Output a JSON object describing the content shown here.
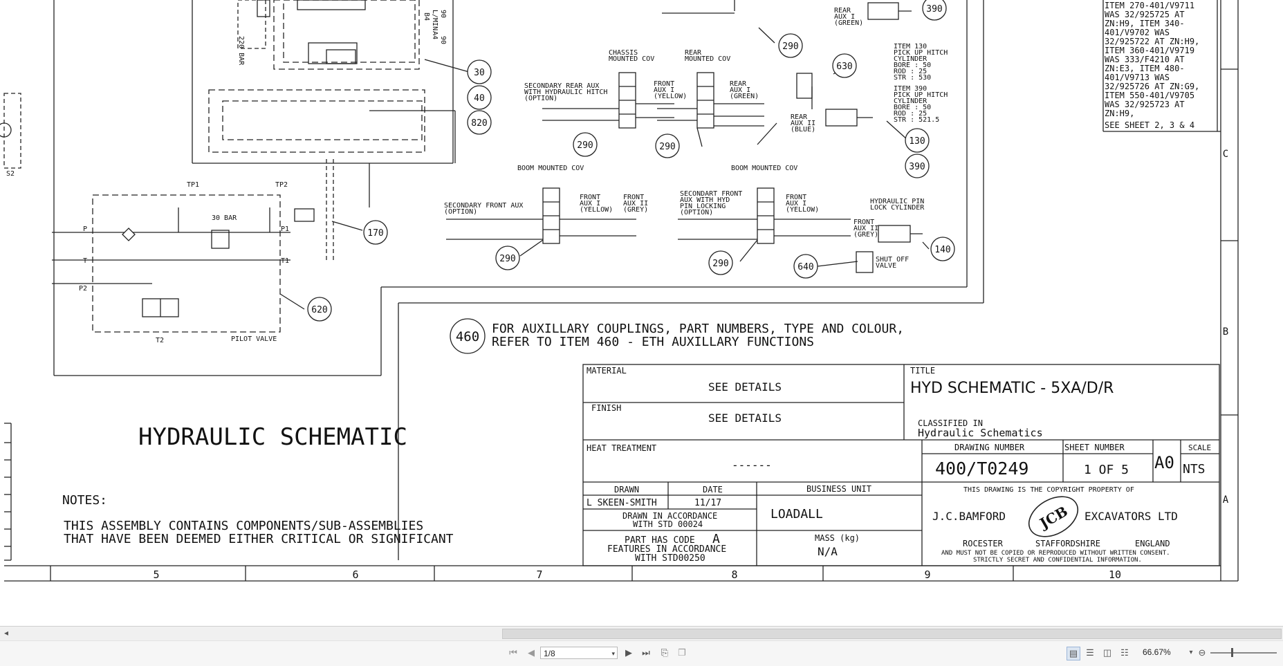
{
  "drawing": {
    "notes_top_right": [
      "ITEM 270-401/V9711",
      "WAS 32/925725 AT",
      "ZN:H9, ITEM 340-",
      "401/V9702 WAS",
      "32/925722 AT ZN:H9,",
      "ITEM 360-401/V9719",
      "WAS 333/F4210 AT",
      "ZN:E3, ITEM 480-",
      "401/V9713 WAS",
      "32/925726 AT ZN:G9,",
      "ITEM 550-401/V9705",
      "WAS 32/925723 AT",
      "ZN:H9,",
      "SEE SHEET 2, 3 & 4"
    ],
    "row_letters": [
      "C",
      "B",
      "A"
    ],
    "column_numbers": [
      "5",
      "6",
      "7",
      "8",
      "9",
      "10"
    ],
    "balloons": {
      "b30": "30",
      "b40": "40",
      "b820": "820",
      "b630": "630",
      "b290a": "290",
      "b290b": "290",
      "b290c": "290",
      "b290d": "290",
      "b290e": "290",
      "b390a": "390",
      "b130": "130",
      "b390b": "390",
      "b170": "170",
      "b620": "620",
      "b140": "140",
      "b640": "640",
      "b460": "460"
    },
    "labels": {
      "chassis_cov": [
        "CHASSIS",
        "MOUNTED COV"
      ],
      "rear_cov": [
        "REAR",
        "MOUNTED COV"
      ],
      "boom_cov_1": "BOOM MOUNTED COV",
      "boom_cov_2": "BOOM MOUNTED COV",
      "sec_rear_aux": [
        "SECONDARY REAR AUX",
        "WITH HYDRAULIC HITCH",
        "(OPTION)"
      ],
      "front_aux_yellow_1": [
        "FRONT",
        "AUX I",
        "(YELLOW)"
      ],
      "rear_aux_green": [
        "REAR",
        "AUX I",
        "(GREEN)"
      ],
      "rear_aux_green_top": [
        "REAR",
        "AUX I",
        "(GREEN)"
      ],
      "rear_aux_blue": [
        "REAR",
        "AUX II",
        "(BLUE)"
      ],
      "item130": [
        "ITEM 130",
        "PICK UP HITCH",
        "CYLINDER",
        "BORE  :  50",
        "ROD   :  25",
        "STR   :  530"
      ],
      "item390": [
        "ITEM 390",
        "PICK UP HITCH",
        "CYLINDER",
        "BORE  :  50",
        "ROD   :  25",
        "STR   :  521.5"
      ],
      "sec_front_aux": [
        "SECONDARY FRONT AUX",
        "(OPTION)"
      ],
      "front_aux_yellow_2": [
        "FRONT",
        "AUX I",
        "(YELLOW)"
      ],
      "front_aux_grey_2": [
        "FRONT",
        "AUX II",
        "(GREY)"
      ],
      "sec_front_aux_pin": [
        "SECONDART FRONT",
        "AUX WITH HYD",
        "PIN LOCKING",
        "(OPTION)"
      ],
      "front_aux_yellow_3": [
        "FRONT",
        "AUX I",
        "(YELLOW)"
      ],
      "front_aux_grey_3": [
        "FRONT",
        "AUX II",
        "(GREY)"
      ],
      "hyd_pin_lock": [
        "HYDRAULIC PIN",
        "LOCK CYLINDER"
      ],
      "shut_off": [
        "SHUT OFF",
        "VALVE"
      ],
      "tp1": "TP1",
      "tp2": "TP2",
      "bar30": "30 BAR",
      "pilot_valve": "PILOT VALVE",
      "t2": "T2",
      "port_p": "P",
      "port_t": "T",
      "port_p2": "P2",
      "port_p1": "P1",
      "port_t1": "T1",
      "s2": "S2",
      "bar220": "220 BAR",
      "b4": "B4",
      "a4": "A4",
      "v90a": "90",
      "v90b": "90",
      "lmin": "L/MIN"
    },
    "aux_note": [
      "FOR AUXILLARY COUPLINGS, PART NUMBERS, TYPE AND COLOUR,",
      "REFER TO ITEM 460 - ETH AUXILLARY FUNCTIONS"
    ],
    "main_title": "HYDRAULIC SCHEMATIC",
    "notes_title": "NOTES:",
    "notes_text": [
      "THIS ASSEMBLY CONTAINS COMPONENTS/SUB-ASSEMBLIES",
      "THAT HAVE BEEN DEEMED EITHER CRITICAL OR SIGNIFICANT"
    ],
    "title_block": {
      "material_label": "MATERIAL",
      "material_value": "SEE DETAILS",
      "finish_label": "FINISH",
      "finish_value": "SEE DETAILS",
      "heat_label": "HEAT TREATMENT",
      "heat_value": "------",
      "drawn_label": "DRAWN",
      "date_label": "DATE",
      "drawn_value": "L SKEEN-SMITH",
      "date_value": "11/17",
      "accordance": [
        "DRAWN IN ACCORDANCE",
        "WITH STD 00024"
      ],
      "part_code": [
        "PART HAS CODE",
        "FEATURES IN ACCORDANCE",
        "WITH STD00250"
      ],
      "code_letter": "A",
      "business_label": "BUSINESS UNIT",
      "business_value": "LOADALL",
      "mass_label": "MASS (kg)",
      "mass_value": "N/A",
      "title_label": "TITLE",
      "title_value": "HYD SCHEMATIC - 5XA/D/R",
      "classified_label": "CLASSIFIED IN",
      "classified_value": "Hydraulic Schematics",
      "drawing_number_label": "DRAWING NUMBER",
      "drawing_number": "400/T0249",
      "sheet_number_label": "SHEET NUMBER",
      "sheet_number": "1 OF 5",
      "size": "A0",
      "scale_label": "SCALE",
      "scale_value": "NTS",
      "copyright_top": "THIS DRAWING IS THE COPYRIGHT PROPERTY OF",
      "company_left": "J.C.BAMFORD",
      "company_right": "EXCAVATORS LTD",
      "logo": "JCB",
      "address": [
        "ROCESTER",
        "STAFFORDSHIRE",
        "ENGLAND"
      ],
      "copy_notice": [
        "AND MUST NOT BE COPIED OR REPRODUCED WITHOUT WRITTEN CONSENT.",
        "STRICTLY SECRET AND CONFIDENTIAL INFORMATION."
      ]
    }
  },
  "viewer": {
    "page_value": "1/8",
    "zoom": "66.67%",
    "icons": [
      "first-page-icon",
      "prev-page-icon",
      "next-page-icon",
      "last-page-icon",
      "page-copy-icon",
      "page-paste-icon",
      "single-page-view-icon",
      "continuous-view-icon",
      "two-page-view-icon",
      "facing-view-icon",
      "zoom-dropdown-icon",
      "zoom-out-icon"
    ]
  }
}
